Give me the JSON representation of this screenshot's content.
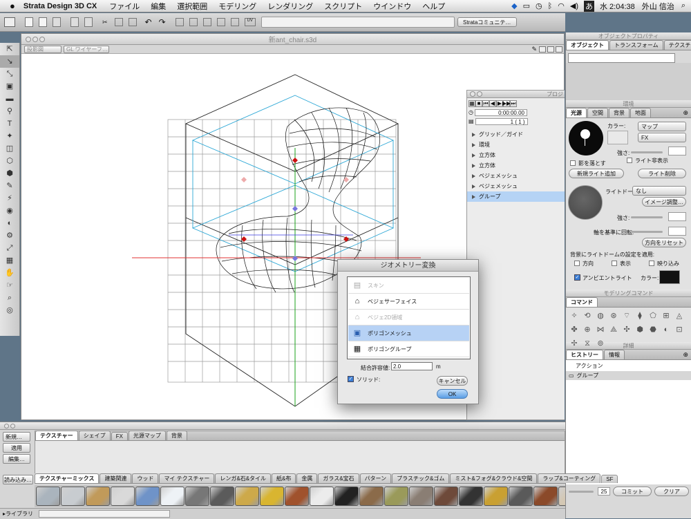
{
  "menubar": {
    "app": "Strata Design 3D CX",
    "items": [
      "ファイル",
      "編集",
      "選択範囲",
      "モデリング",
      "レンダリング",
      "スクリプト",
      "ウインドウ",
      "ヘルプ"
    ],
    "ime": "あ",
    "clock": "水 2:04:38",
    "user": "外山 信治"
  },
  "toolbar": {
    "community": "Strataコミュニテ…"
  },
  "document": {
    "title": "新ant_chair.s3d",
    "view_select": "投影図",
    "render_select": "GL ワイヤーフ…"
  },
  "project": {
    "title": "プロジ",
    "timecode": "0:00:00.00",
    "frame": "1 ( 1 )",
    "items": [
      "グリッド／ガイド",
      "環境",
      "立方体",
      "立方体",
      "ベジェメッシュ",
      "ベジェメッシュ",
      "グループ"
    ],
    "selected_index": 6
  },
  "dialog": {
    "title": "ジオメトリー変換",
    "options": [
      {
        "label": "スキン",
        "enabled": false
      },
      {
        "label": "ベジェサーフェイス",
        "enabled": true
      },
      {
        "label": "ベジェ2D領域",
        "enabled": false
      },
      {
        "label": "ポリゴンメッシュ",
        "enabled": true
      },
      {
        "label": "ポリゴングループ",
        "enabled": true
      }
    ],
    "selected_index": 3,
    "tolerance_label": "結合許容値:",
    "tolerance_value": "2.0",
    "unit": "m",
    "solid_label": "ソリッド:",
    "cancel": "キャンセル",
    "ok": "OK"
  },
  "object_props": {
    "title": "オブジェクトプロパティ",
    "tabs": [
      "オブジェクト",
      "トランスフォーム",
      "テクスチャー"
    ]
  },
  "environment": {
    "title": "環境",
    "tabs": [
      "光源",
      "空間",
      "背景",
      "地面"
    ],
    "color_label": "カラー:",
    "map": "マップ",
    "fx": "FX",
    "strength": "強さ:",
    "shadow": "影を落とす",
    "hide_light": "ライト非表示",
    "add_light": "新規ライト追加",
    "delete_light": "ライト削除",
    "light_dome": "ライトドーム:",
    "light_dome_value": "なし",
    "image_adjust": "イメージ調整…",
    "axis_rotate": "軸を基準に回転:",
    "reset_direction": "方向をリセット",
    "apply_bg": "背景にライトドームの設定を適用:",
    "direction": "方向",
    "display": "表示",
    "reflection": "映り込み",
    "ambient": "アンビエントライト",
    "ambient_color": "カラー:"
  },
  "modeling": {
    "title": "モデリングコマンド",
    "tab": "コマンド"
  },
  "details": {
    "title": "詳細",
    "tabs": [
      "ヒストリー",
      "情報"
    ],
    "header": "アクション",
    "row": "グループ",
    "value": "25",
    "commit": "コミット",
    "clear": "クリア"
  },
  "resource": {
    "buttons": [
      "新規…",
      "適用",
      "編集…",
      "読み込み…"
    ],
    "tabs": [
      "テクスチャー",
      "シェイプ",
      "FX",
      "光源マップ",
      "背景"
    ],
    "library_tabs": [
      "テクスチャーミックス",
      "建築関連",
      "ウッド",
      "マイ テクスチャー",
      "レンガ&石&タイル",
      "紙&布",
      "金属",
      "ガラス&宝石",
      "パターン",
      "プラスチック&ゴム",
      "ミスト&フォグ&クラウド&空間",
      "ラップ&コーティング",
      "SF"
    ],
    "footer": "▸ライブラリ",
    "swatch_colors": [
      "#aab4bd",
      "#c8ccd0",
      "#c19a5a",
      "#d9d9d9",
      "#6f93c8",
      "#eef2f6",
      "#777",
      "#5b5b5b",
      "#cda94a",
      "#d9b530",
      "#a0522d",
      "#ececec",
      "#222",
      "#8b6b4a",
      "#9a9a5a",
      "#8a7e74",
      "#6e4a3a",
      "#333",
      "#c9a032",
      "#5a5a5a",
      "#8b4a2a",
      "#d4c8b4",
      "#a37a6a",
      "#888",
      "#b68b6a"
    ]
  }
}
